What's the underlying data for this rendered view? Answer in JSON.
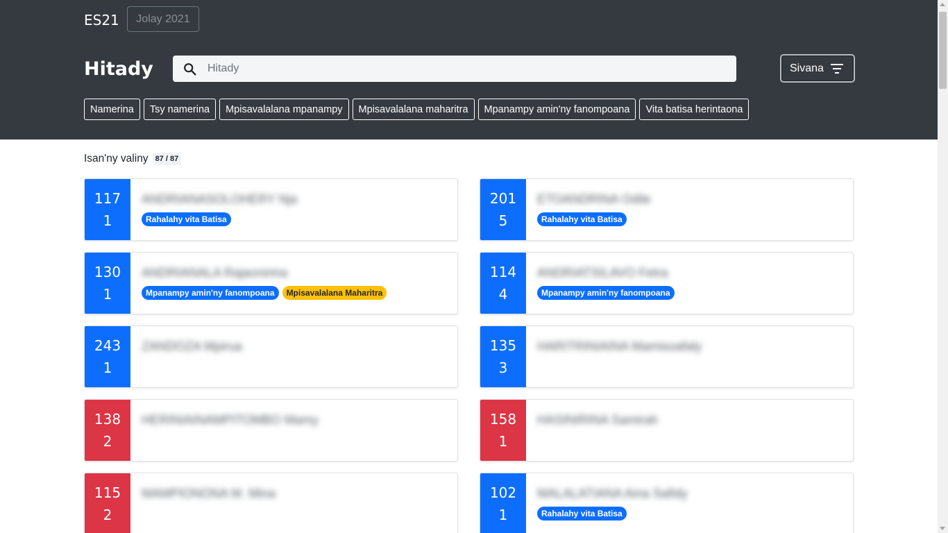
{
  "navbar": {
    "brand": "ES21",
    "period": "Jolay 2021"
  },
  "search": {
    "title": "Hitady",
    "placeholder": "Hitady",
    "filter_label": "Sivana"
  },
  "filters": [
    "Namerina",
    "Tsy namerina",
    "Mpisavalalana mpanampy",
    "Mpisavalalana maharitra",
    "Mpanampy amin'ny fanompoana",
    "Vita batisa herintaona"
  ],
  "results": {
    "label": "Isan'ny valiny",
    "count": "87 / 87"
  },
  "colors": {
    "blue": "#0d6efd",
    "red": "#dc3545",
    "yellow": "#ffc107",
    "header": "#343a40"
  },
  "cards": [
    {
      "num": "117",
      "sub": "1",
      "name": "ANDRIANASOLOHERY Nja",
      "color": "blue",
      "badges": [
        {
          "text": "Rahalahy vita Batisa",
          "color": "blue"
        }
      ]
    },
    {
      "num": "201",
      "sub": "5",
      "name": "ETOANDRINA Odile",
      "color": "blue",
      "badges": [
        {
          "text": "Rahalahy vita Batisa",
          "color": "blue"
        }
      ]
    },
    {
      "num": "130",
      "sub": "1",
      "name": "ANDRIANALA Rajaonirina",
      "color": "blue",
      "badges": [
        {
          "text": "Mpanampy amin'ny fanompoana",
          "color": "blue"
        },
        {
          "text": "Mpisavalalana Maharitra",
          "color": "yellow"
        }
      ]
    },
    {
      "num": "114",
      "sub": "4",
      "name": "ANDRIATSILAVO Fetra",
      "color": "blue",
      "badges": [
        {
          "text": "Mpanampy amin'ny fanompoana",
          "color": "blue"
        }
      ]
    },
    {
      "num": "243",
      "sub": "1",
      "name": "ZANDOZA Mpirua",
      "color": "blue",
      "badges": []
    },
    {
      "num": "135",
      "sub": "3",
      "name": "HARITRINIAINA Mamisoafaly",
      "color": "blue",
      "badges": []
    },
    {
      "num": "138",
      "sub": "2",
      "name": "HERINIAINAMPITOMBO Mamy",
      "color": "red",
      "badges": []
    },
    {
      "num": "158",
      "sub": "1",
      "name": "HASINIRINA Samirah",
      "color": "red",
      "badges": []
    },
    {
      "num": "115",
      "sub": "2",
      "name": "MAMPIONONA M. Mina",
      "color": "red",
      "badges": []
    },
    {
      "num": "102",
      "sub": "1",
      "name": "MALALATIANA Aina Safidy",
      "color": "blue",
      "badges": [
        {
          "text": "Rahalahy vita Batisa",
          "color": "blue"
        }
      ]
    }
  ]
}
